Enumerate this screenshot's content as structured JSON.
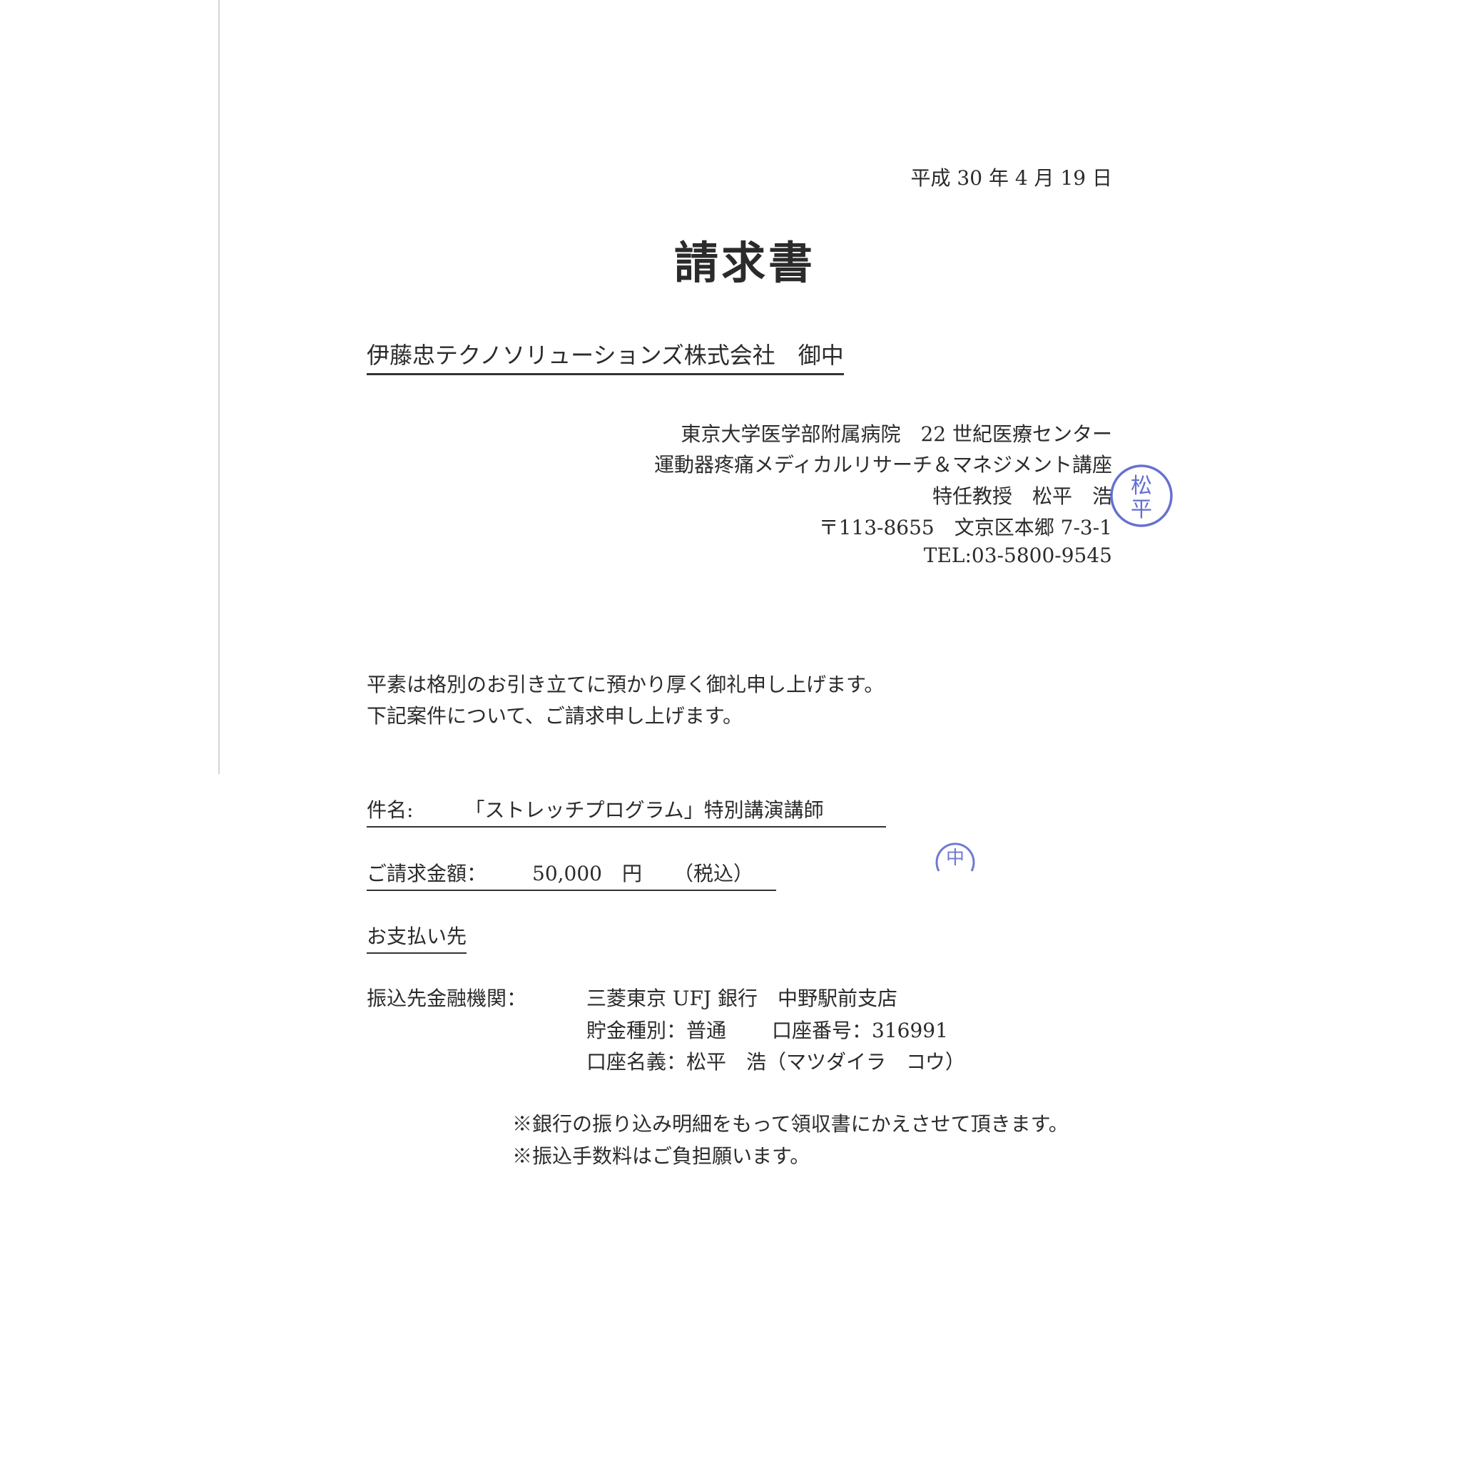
{
  "date": "平成 30 年 4 月 19 日",
  "title": "請求書",
  "recipient": "伊藤忠テクノソリューションズ株式会社　御中",
  "issuer": {
    "line1": "東京大学医学部附属病院　22 世紀医療センター",
    "line2": "運動器疼痛メディカルリサーチ＆マネジメント講座",
    "line3": "特任教授　松平　浩",
    "address": "〒113-8655　文京区本郷 7-3-1",
    "tel": "TEL:03-5800-9545"
  },
  "seal_main": {
    "chars": "松平",
    "color": "#4a57c8"
  },
  "seal_small": {
    "chars": "中",
    "color": "#4a57c8"
  },
  "greeting": {
    "line1": "平素は格別のお引き立てに預かり厚く御礼申し上げます。",
    "line2": "下記案件について、ご請求申し上げます。"
  },
  "subject": {
    "label": "件名:",
    "value": "「ストレッチプログラム」特別講演講師"
  },
  "amount": {
    "label": "ご請求金額：",
    "value": "50,000",
    "unit": "円",
    "tax": "（税込）"
  },
  "payment_heading": "お支払い先",
  "bank": {
    "label": "振込先金融機関：",
    "name": "三菱東京 UFJ 銀行　中野駅前支店",
    "type": "貯金種別：普通",
    "account": "口座番号：316991",
    "holder": "口座名義：松平　浩（マツダイラ　コウ）"
  },
  "notes": [
    "※銀行の振り込み明細をもって領収書にかえさせて頂きます。",
    "※振込手数料はご負担願います。"
  ]
}
